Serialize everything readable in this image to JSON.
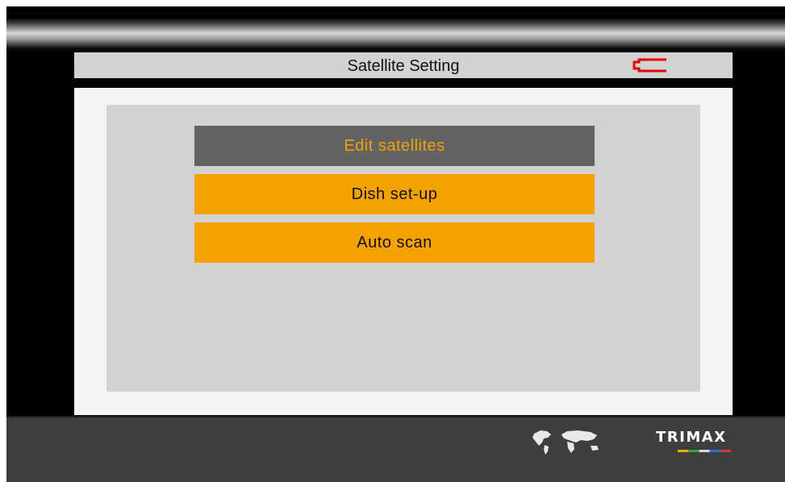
{
  "header": {
    "title": "Satellite Setting",
    "battery_icon": "battery-icon",
    "battery_color": "#e60000"
  },
  "menu": {
    "items": [
      {
        "label": "Edit satellites",
        "selected": true
      },
      {
        "label": "Dish set-up",
        "selected": false
      },
      {
        "label": "Auto scan",
        "selected": false
      }
    ]
  },
  "footer": {
    "world_map_icon": "world-map-icon",
    "brand": "TRIMAX"
  },
  "colors": {
    "accent": "#f5a100",
    "selected_bg": "#636363",
    "panel_bg": "#d2d2d2",
    "screen_bg": "#000000",
    "footer_bg": "#3e3e3e"
  }
}
